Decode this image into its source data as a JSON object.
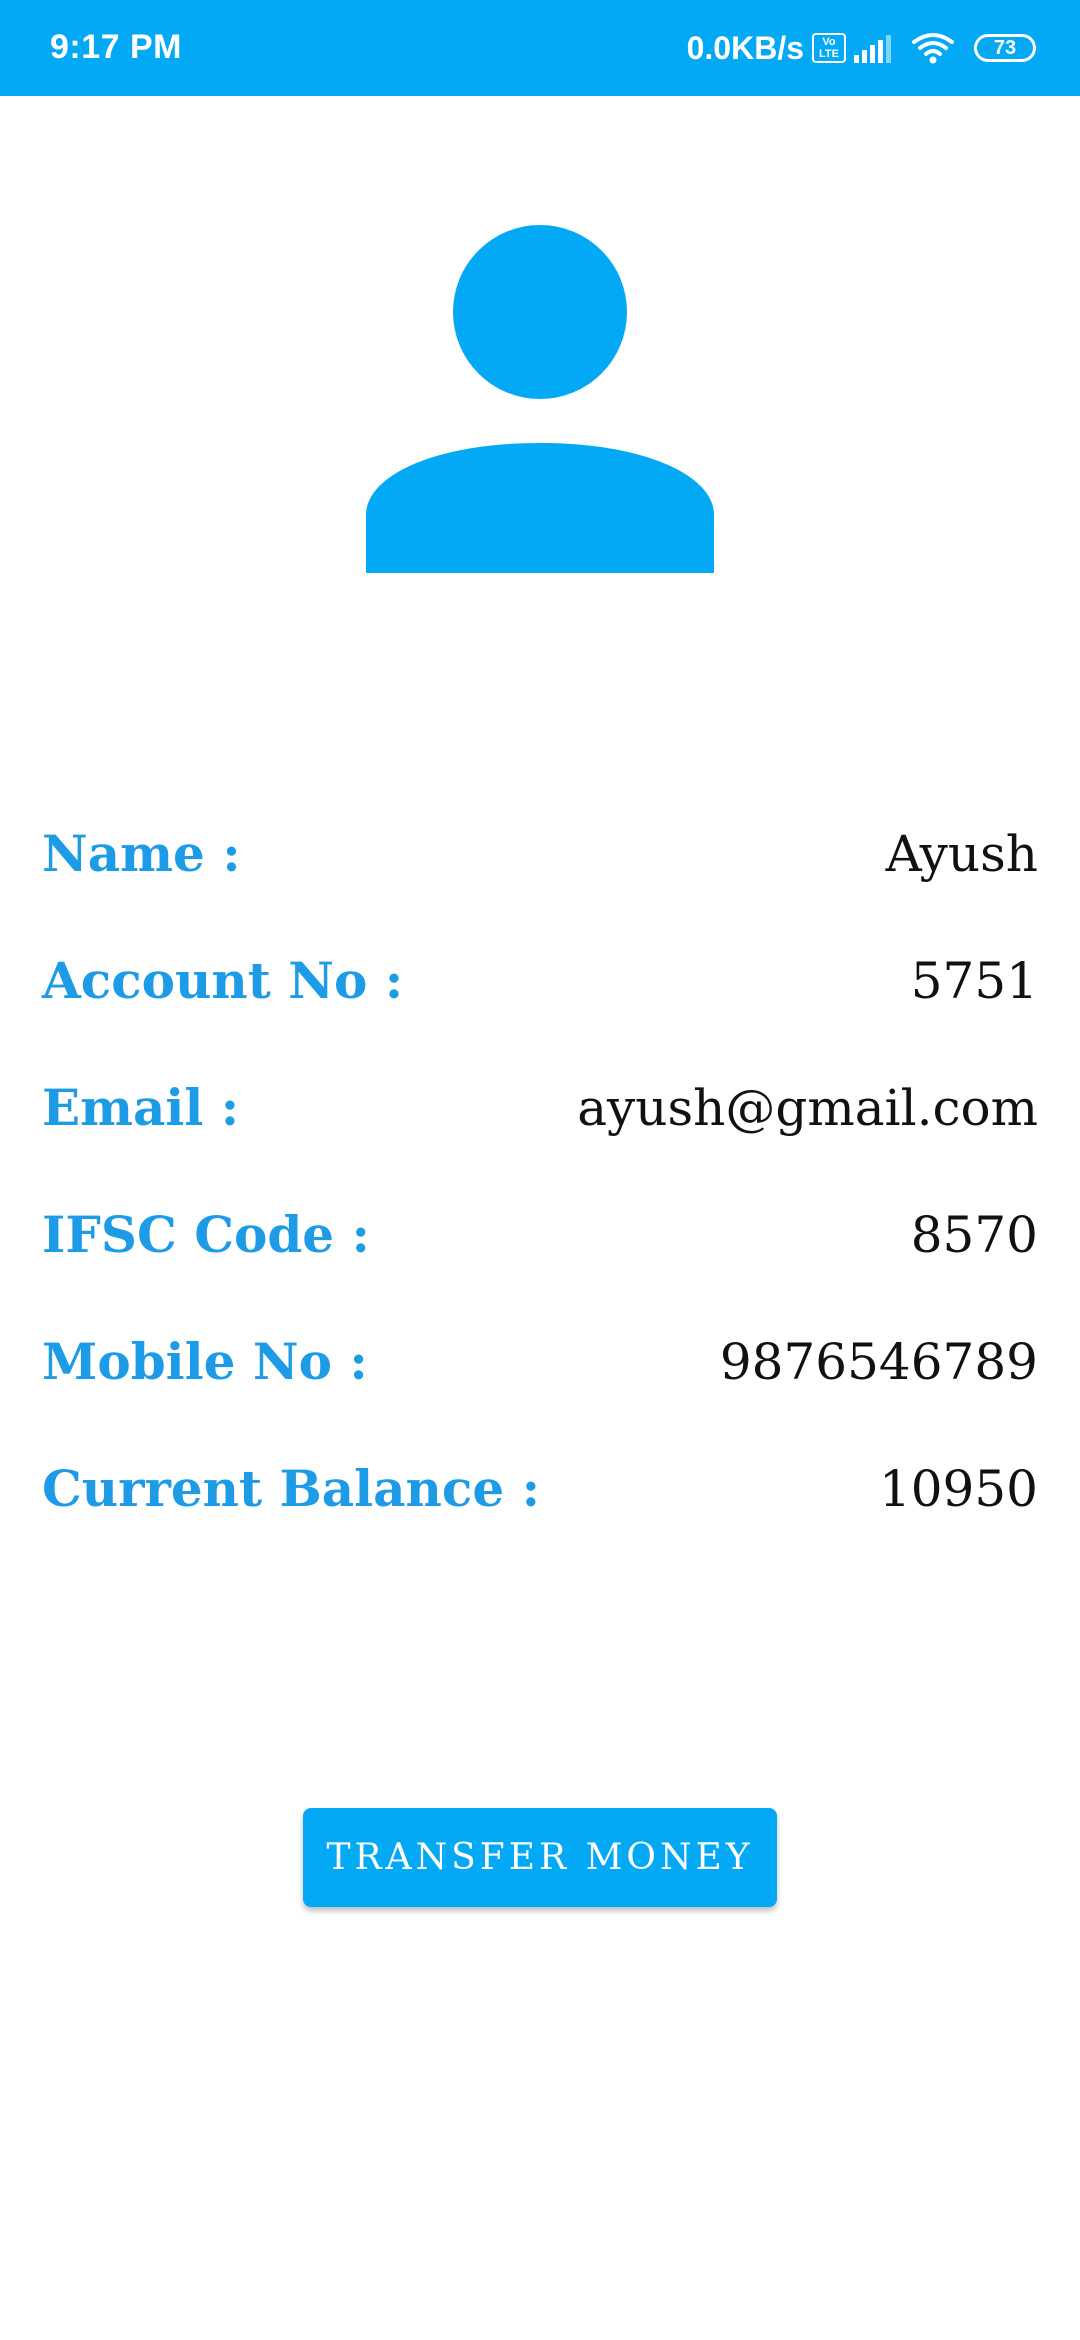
{
  "status_bar": {
    "time": "9:17 PM",
    "network_speed": "0.0KB/s",
    "volte_top": "Vo",
    "volte_bottom": "LTE",
    "battery_level": "73",
    "signal_icon": "signal-bars-icon",
    "wifi_icon": "wifi-icon",
    "background_color": "#03A9F4"
  },
  "avatar": {
    "icon": "person-icon",
    "color": "#03A9F4"
  },
  "details": [
    {
      "label": "Name :",
      "value": "Ayush"
    },
    {
      "label": "Account No :",
      "value": "5751"
    },
    {
      "label": "Email :",
      "value": "ayush@gmail.com"
    },
    {
      "label": "IFSC Code :",
      "value": "8570"
    },
    {
      "label": "Mobile No :",
      "value": "9876546789"
    },
    {
      "label": "Current Balance :",
      "value": "10950"
    }
  ],
  "colors": {
    "label": "#1E9BE6",
    "value": "#111111",
    "accent": "#03A9F4"
  },
  "button": {
    "label": "TRANSFER MONEY"
  }
}
